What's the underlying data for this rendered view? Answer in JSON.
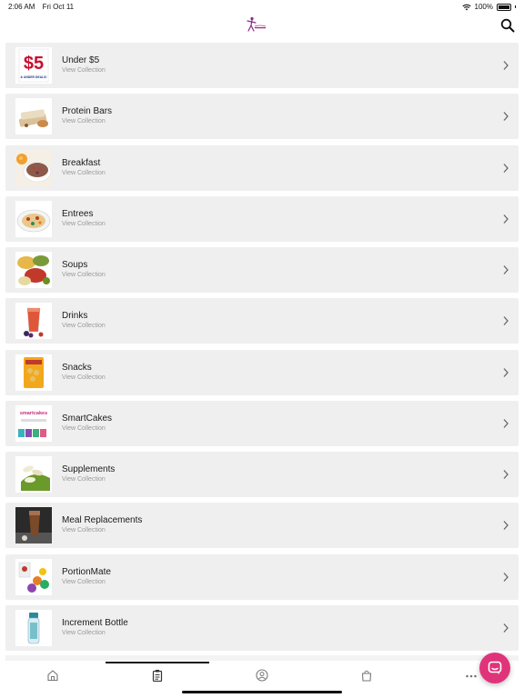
{
  "status_bar": {
    "time": "2:06 AM",
    "date": "Fri Oct 11",
    "battery": "100%",
    "icons": [
      "wifi-icon",
      "battery-icon"
    ]
  },
  "header": {
    "logo": "brand-logo",
    "search_icon": "search-icon"
  },
  "collections": [
    {
      "title": "Under $5",
      "subtitle": "View Collection",
      "thumb": "under-5-image",
      "thumb_text": "$5",
      "thumb_caption": "& UNDER DEALS!"
    },
    {
      "title": "Protein Bars",
      "subtitle": "View Collection",
      "thumb": "protein-bars-image"
    },
    {
      "title": "Breakfast",
      "subtitle": "View Collection",
      "thumb": "breakfast-image"
    },
    {
      "title": "Entrees",
      "subtitle": "View Collection",
      "thumb": "entrees-image"
    },
    {
      "title": "Soups",
      "subtitle": "View Collection",
      "thumb": "soups-image"
    },
    {
      "title": "Drinks",
      "subtitle": "View Collection",
      "thumb": "drinks-image"
    },
    {
      "title": "Snacks",
      "subtitle": "View Collection",
      "thumb": "snacks-image"
    },
    {
      "title": "SmartCakes",
      "subtitle": "View Collection",
      "thumb": "smartcakes-image",
      "thumb_text": "smartcakes"
    },
    {
      "title": "Supplements",
      "subtitle": "View Collection",
      "thumb": "supplements-image"
    },
    {
      "title": "Meal Replacements",
      "subtitle": "View Collection",
      "thumb": "meal-replacements-image"
    },
    {
      "title": "PortionMate",
      "subtitle": "View Collection",
      "thumb": "portionmate-image"
    },
    {
      "title": "Increment Bottle",
      "subtitle": "View Collection",
      "thumb": "increment-bottle-image"
    }
  ],
  "tabbar": {
    "active_tab": "collections",
    "tabs": [
      "home-icon",
      "clipboard-icon",
      "account-icon",
      "bag-icon",
      "more-icon"
    ]
  },
  "chat": {
    "icon": "chat-icon"
  },
  "colors": {
    "accent": "#e0347a",
    "row_bg": "#efefef",
    "subtitle": "#9a9a9a"
  }
}
